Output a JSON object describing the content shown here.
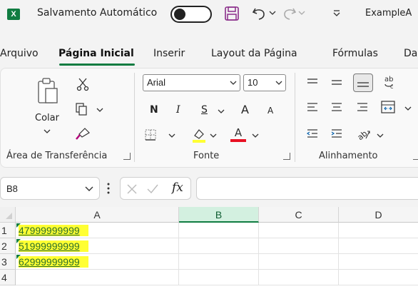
{
  "titlebar": {
    "app_icon": "X",
    "autosave_label": "Salvamento Automático",
    "autosave_state": "off",
    "filename": "ExampleA"
  },
  "tabs": [
    {
      "label": "Arquivo",
      "active": false
    },
    {
      "label": "Página Inicial",
      "active": true
    },
    {
      "label": "Inserir",
      "active": false
    },
    {
      "label": "Layout da Página",
      "active": false
    },
    {
      "label": "Fórmulas",
      "active": false
    },
    {
      "label": "Da",
      "active": false
    }
  ],
  "ribbon": {
    "clipboard": {
      "paste_label": "Colar",
      "group_label": "Área de Transferência"
    },
    "font": {
      "name": "Arial",
      "size": "10",
      "bold": "N",
      "italic": "I",
      "underline": "S",
      "grow": "A",
      "shrink": "A",
      "font_color_letter": "A",
      "group_label": "Fonte"
    },
    "alignment": {
      "group_label": "Alinhamento",
      "wrap_glyph": "ab"
    }
  },
  "formula_bar": {
    "name_box": "B8",
    "fx_label": "fx",
    "formula": ""
  },
  "sheet": {
    "columns": [
      "A",
      "B",
      "C",
      "D"
    ],
    "selected_column": "B",
    "rows": [
      {
        "num": "1",
        "A": "47999999999"
      },
      {
        "num": "2",
        "A": "51999999999"
      },
      {
        "num": "3",
        "A": "62999999999"
      },
      {
        "num": "4",
        "A": ""
      }
    ]
  },
  "colors": {
    "accent": "#107c41",
    "highlight": "#ffff33",
    "link_text": "#2b6e2b",
    "font_color_bar": "#e81123"
  }
}
